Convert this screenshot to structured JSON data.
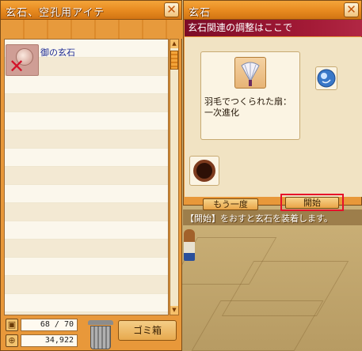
{
  "inventory_window": {
    "title": "玄石、空孔用アイテ",
    "close_glyph": "✕",
    "items": [
      {
        "name": "御の玄石",
        "icon": "white-gem-icon",
        "badge_icon": "red-x-icon"
      }
    ],
    "capacity": "68 / 70",
    "money": "34,922",
    "trash_button_label": "ゴミ箱"
  },
  "genseki_window": {
    "title": "玄石",
    "close_glyph": "✕",
    "hint": "玄石関連の調整はここで",
    "item_description": "羽毛でつくられた扇：一次進化",
    "item_icon": "feather-fan-icon",
    "material_icon": "blue-orb-icon",
    "slot_icon": "dark-ring-icon",
    "retry_button_label": "もう一度",
    "start_button_label": "開始",
    "instruction": "【開始】をおすと玄石を装着します。"
  },
  "colors": {
    "title_orange": "#e78a1f",
    "hint_maroon": "#8b0d2a",
    "highlight_red": "#e6102a",
    "item_name_blue": "#1f2d96"
  }
}
